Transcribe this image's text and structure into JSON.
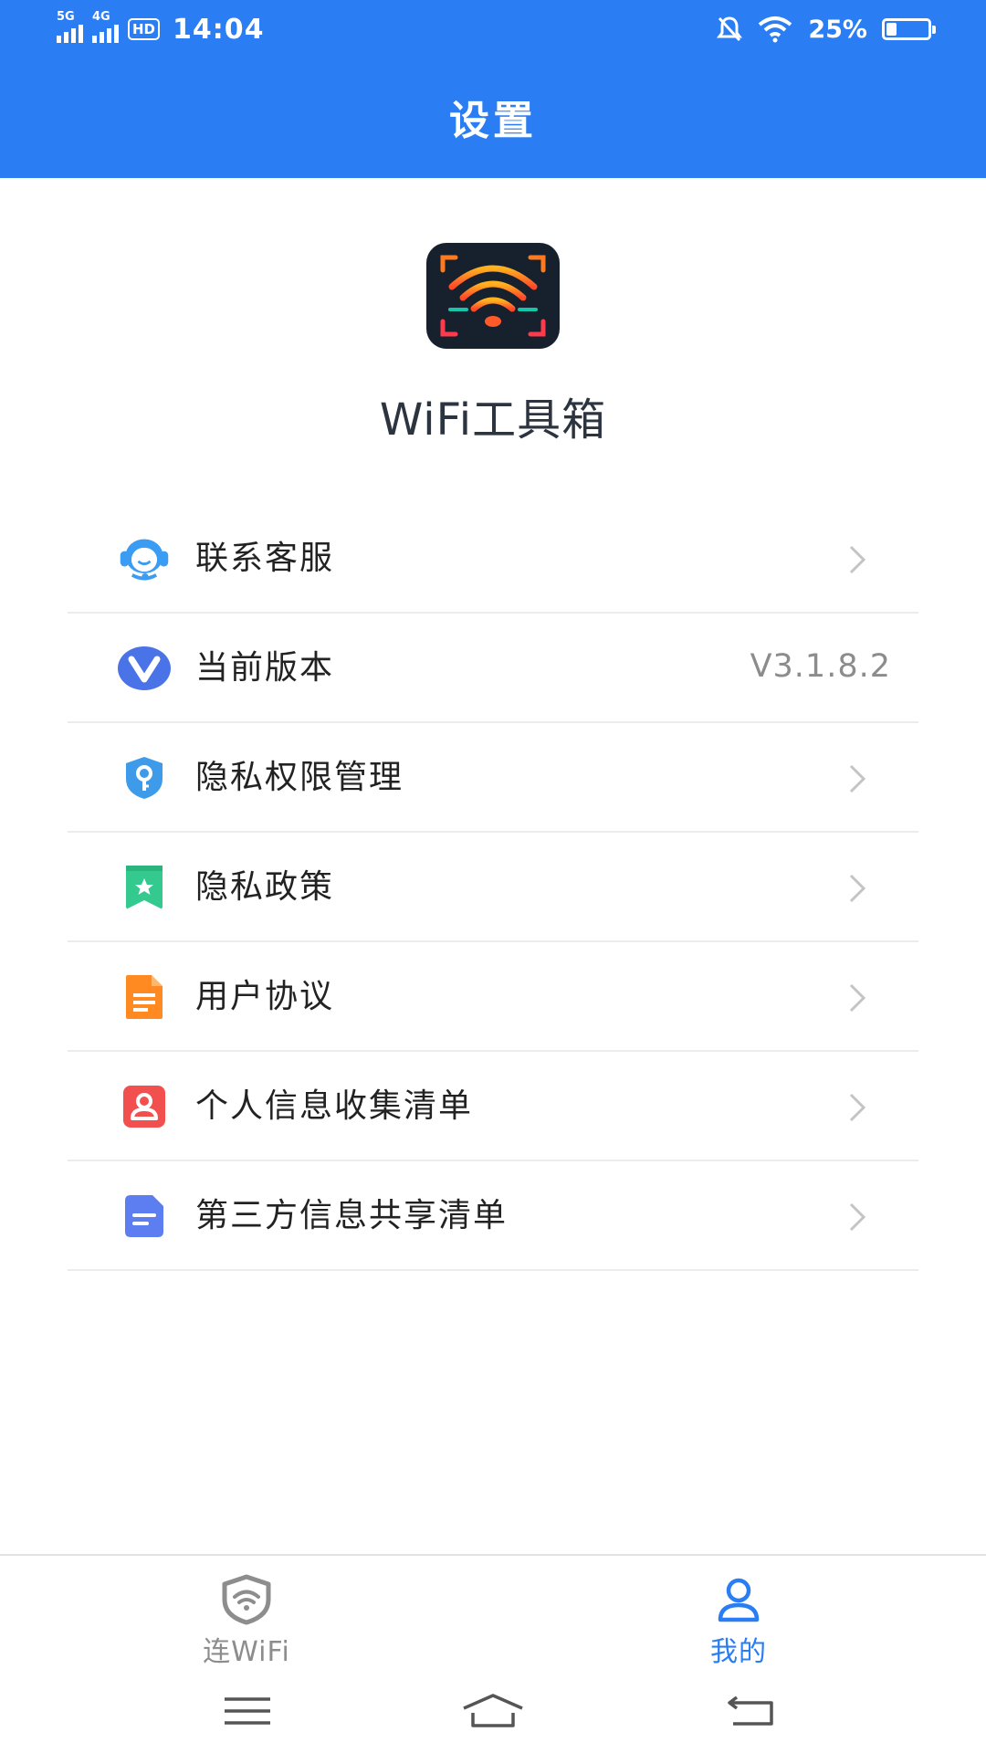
{
  "status_bar": {
    "sim1_tag": "5G",
    "sim2_tag": "4G",
    "hd_badge": "HD",
    "time": "14:04",
    "battery_text": "25%",
    "battery_level": 0.25
  },
  "header": {
    "title": "设置"
  },
  "app": {
    "name": "WiFi工具箱"
  },
  "menu": [
    {
      "label": "联系客服",
      "icon": "customer-service-icon"
    },
    {
      "label": "当前版本",
      "icon": "version-icon",
      "value": "V3.1.8.2"
    },
    {
      "label": "隐私权限管理",
      "icon": "privacy-shield-icon"
    },
    {
      "label": "隐私政策",
      "icon": "privacy-policy-icon"
    },
    {
      "label": "用户协议",
      "icon": "user-agreement-icon"
    },
    {
      "label": "个人信息收集清单",
      "icon": "personal-info-icon"
    },
    {
      "label": "第三方信息共享清单",
      "icon": "third-party-share-icon"
    }
  ],
  "tabbar": {
    "tabs": [
      {
        "label": "连WiFi",
        "icon": "wifi-shield-icon",
        "active": false
      },
      {
        "label": "我的",
        "icon": "user-icon",
        "active": true
      }
    ]
  },
  "colors": {
    "primary": "#2a7df2",
    "inactive_tab": "#8d8d8d",
    "divider": "#ececec"
  }
}
